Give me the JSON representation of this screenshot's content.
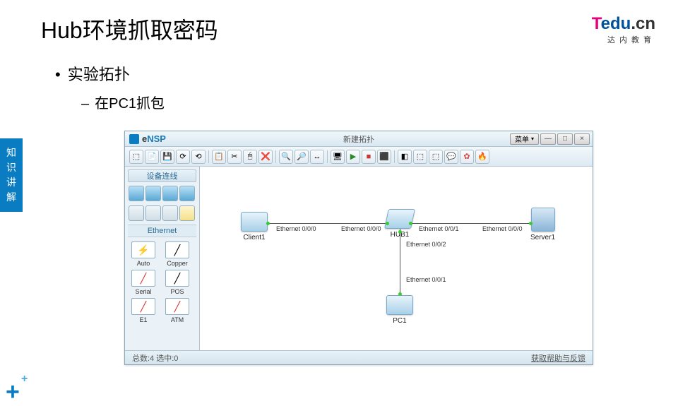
{
  "slide": {
    "title": "Hub环境抓取密码",
    "bullet1": "实验拓扑",
    "bullet2": "在PC1抓包",
    "side_tab": "知识讲解"
  },
  "logo": {
    "t": "T",
    "edu": "edu",
    "cn": ".cn",
    "sub": "达内教育"
  },
  "ensp": {
    "app_e": "e",
    "app_name": "NSP",
    "window_title": "新建拓扑",
    "menu_button": "菜单",
    "win_min": "—",
    "win_max": "□",
    "win_close": "×",
    "palette_header": "设备连线",
    "section": "Ethernet",
    "conn_types": [
      "Auto",
      "Copper",
      "Serial",
      "POS",
      "E1",
      "ATM"
    ],
    "status_left": "总数:4 选中:0",
    "status_right": "获取帮助与反馈"
  },
  "toolbar_icons": [
    "⬚",
    "📄",
    "💾",
    "⟳",
    "⟲",
    "📋",
    "✂",
    "🖱",
    "❌",
    "🔍",
    "🔎",
    "↔",
    "🖥",
    "▶",
    "■",
    "⬛",
    "◧",
    "⬚",
    "⬚",
    "💬",
    "✿",
    "🔥"
  ],
  "topology": {
    "nodes": {
      "client": {
        "label": "Client1"
      },
      "hub": {
        "label": "HUB1"
      },
      "server": {
        "label": "Server1"
      },
      "pc": {
        "label": "PC1"
      }
    },
    "ports": {
      "c_out": "Ethernet 0/0/0",
      "h_left": "Ethernet 0/0/0",
      "h_right": "Ethernet 0/0/1",
      "h_down": "Ethernet 0/0/2",
      "s_in": "Ethernet 0/0/0",
      "p_up": "Ethernet 0/0/1"
    }
  }
}
